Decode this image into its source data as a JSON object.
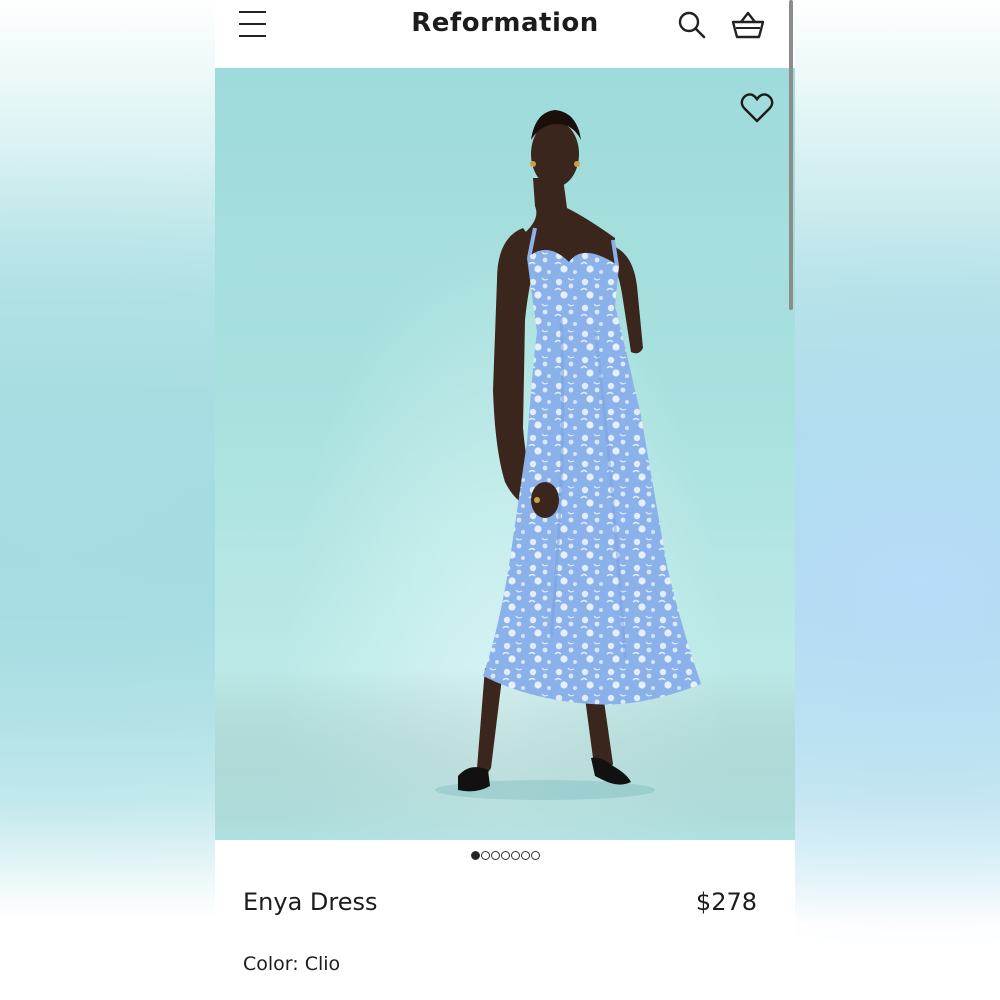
{
  "header": {
    "brand": "Reformation",
    "menu_icon": "hamburger-menu-icon",
    "search_icon": "search-icon",
    "cart_icon": "basket-icon"
  },
  "gallery": {
    "favorite_icon": "heart-icon",
    "image_count": 7,
    "active_index": 0,
    "background_color": "#a9e1df",
    "dress_color": "#8fb4ec"
  },
  "product": {
    "name": "Enya Dress",
    "price": "$278",
    "color_label": "Color:",
    "color_value": "Clio"
  }
}
